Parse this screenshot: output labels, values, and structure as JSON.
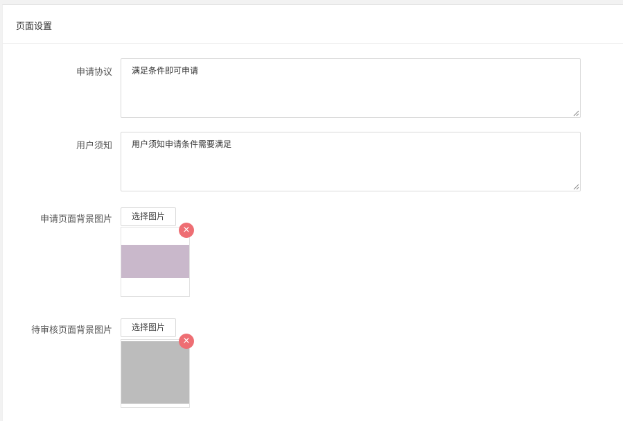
{
  "panel": {
    "title": "页面设置"
  },
  "form": {
    "agreement": {
      "label": "申请协议",
      "value": "满足条件即可申请"
    },
    "notice": {
      "label": "用户须知",
      "value": "用户须知申请条件需要满足"
    },
    "apply_bg": {
      "label": "申请页面背景图片",
      "button": "选择图片",
      "remove_glyph": "×",
      "preview_color": "#c9b8cb"
    },
    "pending_bg": {
      "label": "待审核页面背景图片",
      "button": "选择图片",
      "remove_glyph": "×",
      "preview_color": "#bcbcbc"
    }
  },
  "colors": {
    "remove_button": "#ee6e73",
    "border": "#d9d9d9"
  }
}
